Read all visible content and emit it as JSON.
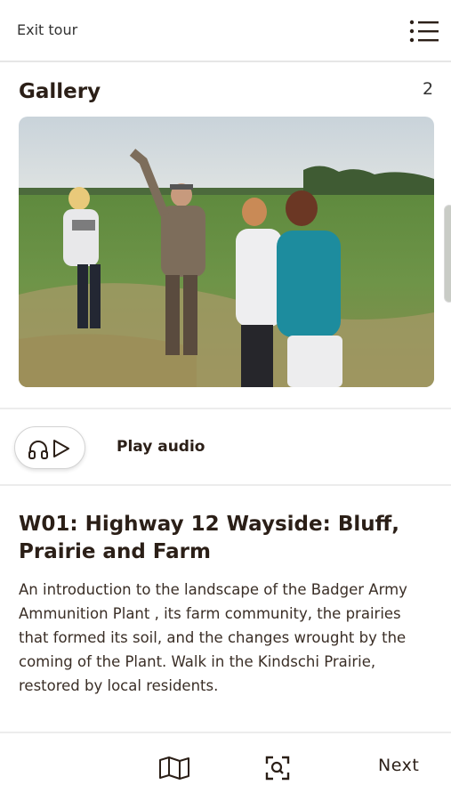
{
  "header": {
    "exit_label": "Exit tour",
    "menu_icon": "list-menu-icon"
  },
  "gallery": {
    "title": "Gallery",
    "count": "2",
    "photo_icon": "photo-image"
  },
  "audio": {
    "button_icon": "headphones-play-icon",
    "label": "Play audio"
  },
  "stop": {
    "title": "W01: Highway 12 Wayside: Bluff, Prairie and Farm",
    "description": "An introduction to the landscape of the Badger Army Ammunition Plant , its farm community, the prairies that formed its soil, and the changes wrought by the coming of the Plant. Walk in the Kindschi Prairie, restored by local residents."
  },
  "footer": {
    "map_icon": "map-icon",
    "scan_icon": "scan-search-icon",
    "next_label": "Next"
  },
  "colors": {
    "text_dark": "#2b1f17",
    "divider": "#ececec"
  }
}
